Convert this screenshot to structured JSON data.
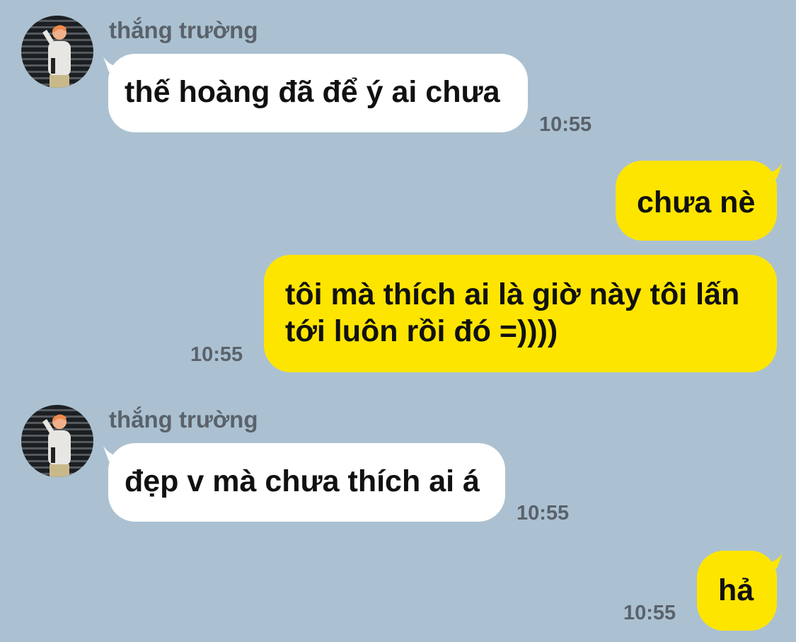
{
  "chat": {
    "colors": {
      "background": "#abc1d1",
      "incoming_bubble": "#ffffff",
      "outgoing_bubble": "#fee500",
      "meta_text": "#5a626b"
    },
    "messages": [
      {
        "direction": "in",
        "sender": "thắng trường",
        "lines": [
          "thế hoàng đã để ý ai chưa"
        ],
        "time": "10:55"
      },
      {
        "direction": "out",
        "lines": [
          "chưa nè"
        ],
        "time": ""
      },
      {
        "direction": "out",
        "lines": [
          "tôi mà thích ai là giờ này tôi lấn",
          "tới luôn rồi đó =))))"
        ],
        "time": "10:55"
      },
      {
        "direction": "in",
        "sender": "thắng trường",
        "lines": [
          "đẹp v mà chưa thích ai á"
        ],
        "time": "10:55"
      },
      {
        "direction": "out",
        "lines": [
          "hả"
        ],
        "time": "10:55"
      }
    ]
  }
}
